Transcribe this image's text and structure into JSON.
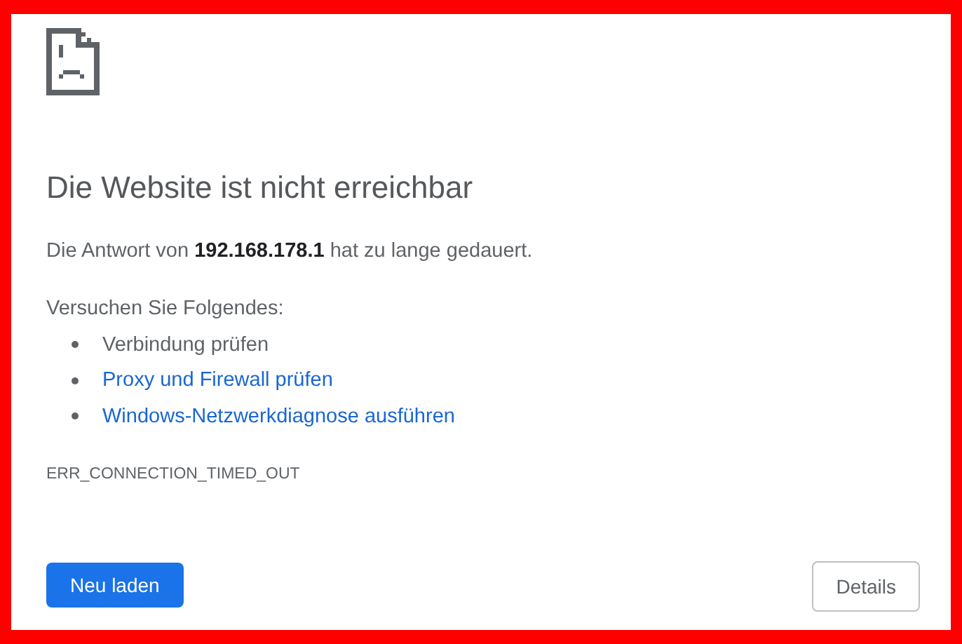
{
  "title": "Die Website ist nicht erreichbar",
  "message": "Die Antwort von **192.168.178.1** hat zu lange gedauert.",
  "suggestions_heading": "Versuchen Sie Folgendes:",
  "suggestions": [
    {
      "kind": "text",
      "label": "Verbindung prüfen"
    },
    {
      "kind": "link",
      "label": "Proxy und Firewall prüfen"
    },
    {
      "kind": "link",
      "label": "Windows-Netzwerkdiagnose ausführen"
    }
  ],
  "error_code": "ERR_CONNECTION_TIMED_OUT",
  "buttons": [
    {
      "kind": "primary",
      "label": "Neu laden"
    },
    {
      "kind": "secondary",
      "label": "Details"
    }
  ]
}
